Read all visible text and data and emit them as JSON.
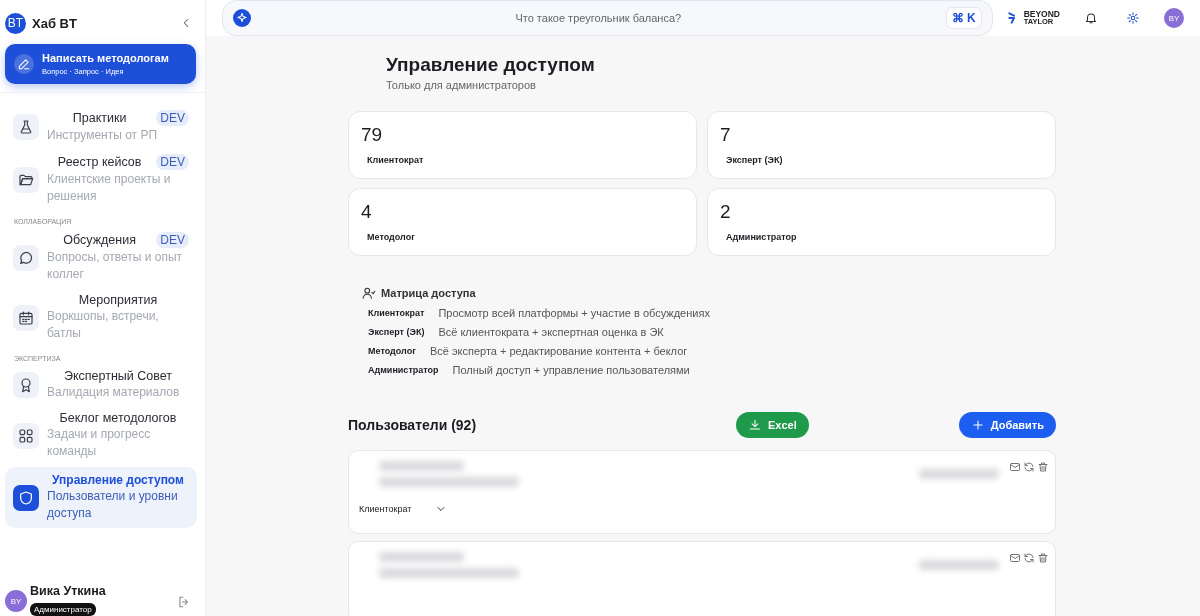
{
  "sidebar": {
    "logo": "BT",
    "title": "Хаб BT",
    "compose": {
      "title": "Написать методологам",
      "subtitle": "Вопрос · Запрос · Идея"
    },
    "items": [
      {
        "kind": "item",
        "title": "Практики",
        "subtitle": "Инструменты от РП",
        "badge": "DEV",
        "selected": false
      },
      {
        "kind": "item",
        "title": "Реестр кейсов",
        "subtitle": "Клиентские проекты и решения",
        "badge": "DEV",
        "selected": false
      },
      {
        "kind": "section",
        "title": "КОЛЛАБОРАЦИЯ"
      },
      {
        "kind": "item",
        "title": "Обсуждения",
        "subtitle": "Вопросы, ответы и опыт коллег",
        "badge": "DEV",
        "selected": false
      },
      {
        "kind": "item",
        "title": "Мероприятия",
        "subtitle": "Воркшопы, встречи, батлы",
        "selected": false
      },
      {
        "kind": "section",
        "title": "ЭКСПЕРТИЗА"
      },
      {
        "kind": "item",
        "title": "Экспертный Совет",
        "subtitle": "Валидация материалов",
        "selected": false
      },
      {
        "kind": "item",
        "title": "Беклог методологов",
        "subtitle": "Задачи и прогресс команды",
        "selected": false
      },
      {
        "kind": "item",
        "title": "Управление доступом",
        "subtitle": "Пользователи и уровни доступа",
        "selected": true
      }
    ],
    "user": {
      "avatar": "BY",
      "name": "Вика Уткина",
      "role": "Администратор"
    }
  },
  "topbar": {
    "search_placeholder": "Что такое треугольник баланса?",
    "shortcut": "⌘ K",
    "brand_top": "BEYOND",
    "brand_bottom": "TAYLOR",
    "avatar": "BY"
  },
  "page": {
    "title": "Управление доступом",
    "subtitle": "Только для администраторов",
    "stats": [
      {
        "value": "79",
        "label": "Клиентократ"
      },
      {
        "value": "7",
        "label": "Эксперт (ЭК)"
      },
      {
        "value": "4",
        "label": "Методолог"
      },
      {
        "value": "2",
        "label": "Администратор"
      }
    ],
    "matrix": {
      "title": "Матрица доступа",
      "rows": [
        {
          "role": "Клиентократ",
          "access": "Просмотр всей платформы + участие в обсуждениях"
        },
        {
          "role": "Эксперт (ЭК)",
          "access": "Всё клиентократа + экспертная оценка в ЭК"
        },
        {
          "role": "Методолог",
          "access": "Всё эксперта + редактирование контента + беклог"
        },
        {
          "role": "Администратор",
          "access": "Полный доступ + управление пользователями"
        }
      ]
    },
    "users_title": "Пользователи (92)",
    "excel": "Excel",
    "add": "Добавить",
    "users": [
      {
        "kind": "user",
        "role": "Клиентократ"
      },
      {
        "kind": "user"
      }
    ]
  }
}
